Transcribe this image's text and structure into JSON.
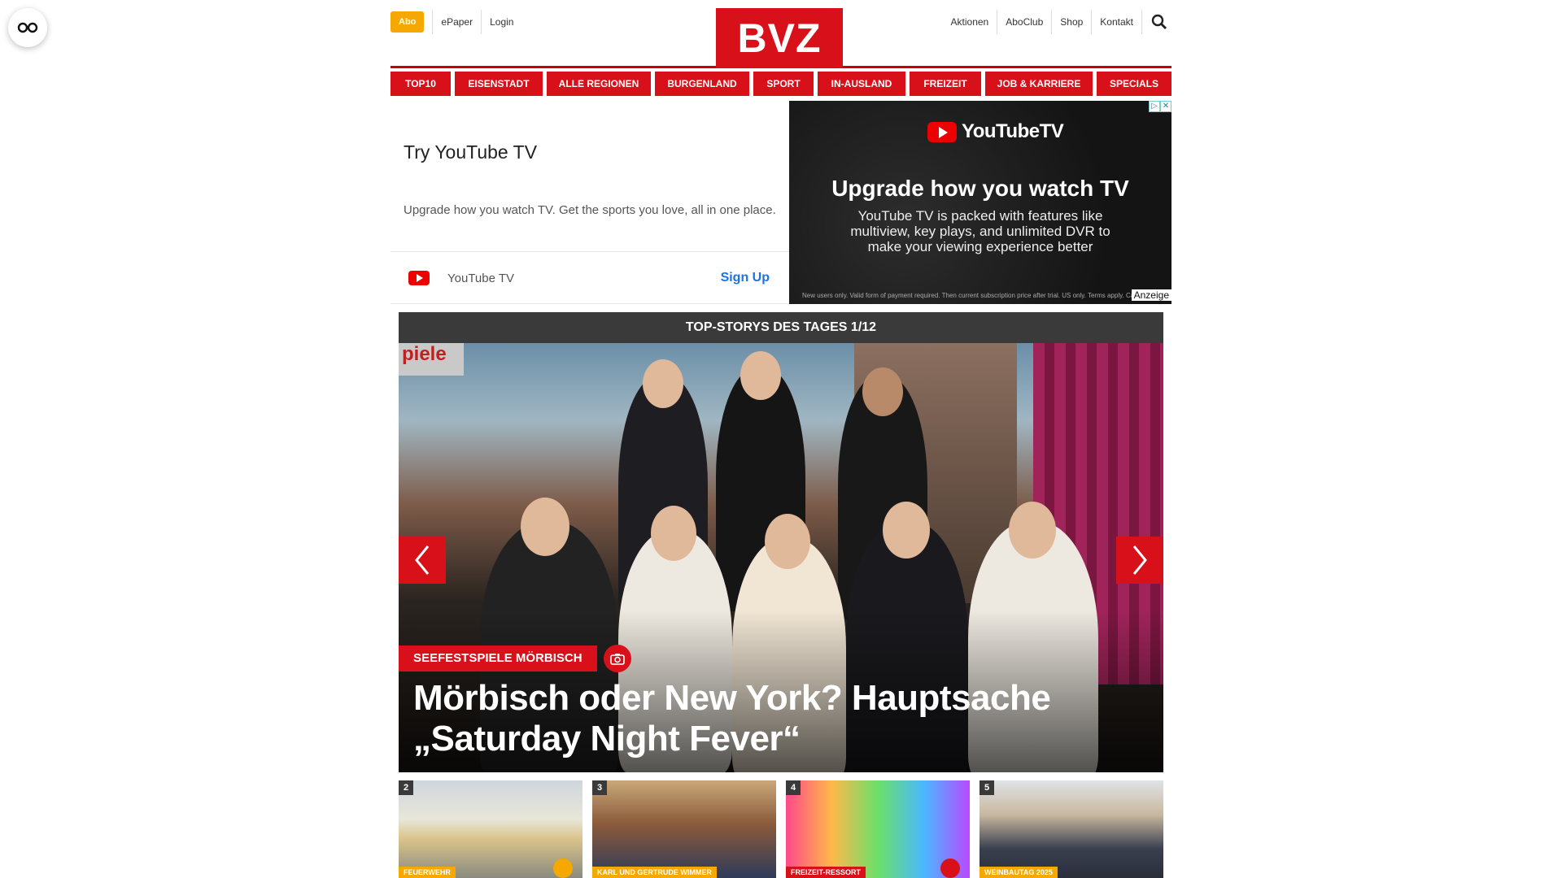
{
  "header": {
    "abo_label": "Abo",
    "left_links": [
      "ePaper",
      "Login"
    ],
    "logo_text": "BVZ",
    "right_links": [
      "Aktionen",
      "AboClub",
      "Shop",
      "Kontakt"
    ]
  },
  "nav": {
    "items": [
      "TOP10",
      "EISENSTADT",
      "ALLE REGIONEN",
      "BURGENLAND",
      "SPORT",
      "IN-AUSLAND",
      "FREIZEIT",
      "JOB & KARRIERE",
      "SPECIALS"
    ]
  },
  "ad": {
    "title": "Try YouTube TV",
    "description": "Upgrade how you watch TV. Get the sports you love, all in one place.",
    "brand": "YouTube TV",
    "cta": "Sign Up",
    "banner_logo": "YouTubeTV",
    "banner_headline": "Upgrade how you watch TV",
    "banner_text": "YouTube TV is packed with features like multiview, key plays, and unlimited DVR to make your viewing experience better",
    "banner_fineprint": "New users only. Valid form of payment required. Then current subscription price after trial. US only. Terms apply. Cancel anytime.",
    "anzeige": "Anzeige"
  },
  "stories": {
    "heading": "TOP-STORYS DES TAGES 1/12",
    "hero_tag": "SEEFESTSPIELE MÖRBISCH",
    "hero_title": "Mörbisch oder New York? Hauptsache „Saturday Night Fever“",
    "hero_sign": "piele"
  },
  "thumbs": [
    {
      "num": "2",
      "tag": "FEUERWEHR"
    },
    {
      "num": "3",
      "tag": "KARL UND GERTRUDE WIMMER"
    },
    {
      "num": "4",
      "tag": "FREIZEIT-RESSORT"
    },
    {
      "num": "5",
      "tag": "WEINBAUTAG 2025"
    }
  ],
  "colors": {
    "brand_red": "#d8101a",
    "abo_yellow": "#f5a800",
    "dark_bar": "#3a3a3a"
  }
}
